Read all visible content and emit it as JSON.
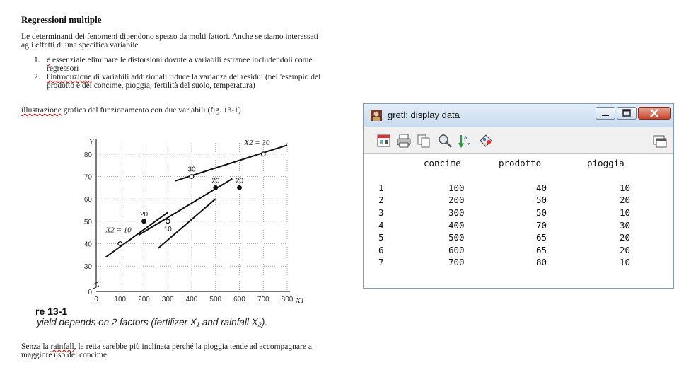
{
  "document": {
    "title": "Regressioni multiple",
    "intro": "Le determinanti dei fenomeni dipendono spesso da molti fattori. Anche se siamo interessati agli effetti di una specifica variabile",
    "list": [
      {
        "num": "1.",
        "word": "è",
        "rest": " essenziale eliminare le distorsioni dovute a variabili estranee includendoli come regressori"
      },
      {
        "num": "2.",
        "word": "l'introduzione",
        "rest": " di variabili addizionali riduce la varianza dei residui (nell'esempio del prodotto e del concime, pioggia, fertilità del suolo, temperatura)"
      }
    ],
    "illustration_word": "illustrazione",
    "illustration_rest": " grafica del funzionamento con due variabili (fig. 13-1)",
    "figure_number": "re 13-1",
    "figure_caption": "yield depends on 2 factors (fertilizer X₁ and rainfall X₂).",
    "footer_pre": "Senza la ",
    "footer_word": "rainfall",
    "footer_post": ", la retta sarebbe più inclinata perché la pioggia tende ad accompagnare a maggiore uso del concime"
  },
  "chart_data": {
    "type": "scatter",
    "title": "",
    "xlabel": "X1",
    "ylabel": "Y",
    "xlim": [
      0,
      800
    ],
    "ylim": [
      0,
      85
    ],
    "xticks": [
      "0",
      "100",
      "200",
      "300",
      "400",
      "500",
      "600",
      "700",
      "800"
    ],
    "yticks": [
      "0",
      "30",
      "40",
      "50",
      "60",
      "70",
      "80"
    ],
    "points": [
      {
        "x": 100,
        "y": 40,
        "label": "",
        "filled": false
      },
      {
        "x": 200,
        "y": 50,
        "label": "20",
        "filled": true
      },
      {
        "x": 300,
        "y": 50,
        "label": "10",
        "filled": false
      },
      {
        "x": 400,
        "y": 70,
        "label": "30",
        "filled": false
      },
      {
        "x": 500,
        "y": 65,
        "label": "20",
        "filled": true
      },
      {
        "x": 600,
        "y": 65,
        "label": "20",
        "filled": true
      },
      {
        "x": 700,
        "y": 80,
        "label": "",
        "filled": false
      }
    ],
    "lines": [
      {
        "name": "X2 = 10",
        "from": [
          40,
          34
        ],
        "to": [
          300,
          54
        ]
      },
      {
        "name": "",
        "from": [
          180,
          44
        ],
        "to": [
          570,
          69
        ]
      },
      {
        "name": "",
        "from": [
          260,
          38
        ],
        "to": [
          500,
          60
        ]
      },
      {
        "name": "X2 = 30",
        "from": [
          330,
          68
        ],
        "to": [
          800,
          84
        ]
      }
    ],
    "annotations": [
      {
        "text": "X2 = 10",
        "x": 40,
        "y": 45
      },
      {
        "text": "X2 = 30",
        "x": 620,
        "y": 84
      }
    ]
  },
  "gretl": {
    "window_title": "gretl: display data",
    "icons": [
      "app-icon",
      "edit-icon",
      "print-icon",
      "copy-icon",
      "search-icon",
      "sort-icon",
      "plot-icon",
      "expand-icon"
    ],
    "columns": [
      "concime",
      "prodotto",
      "pioggia"
    ],
    "rows": [
      {
        "id": "1",
        "values": [
          "100",
          "40",
          "10"
        ]
      },
      {
        "id": "2",
        "values": [
          "200",
          "50",
          "20"
        ]
      },
      {
        "id": "3",
        "values": [
          "300",
          "50",
          "10"
        ]
      },
      {
        "id": "4",
        "values": [
          "400",
          "70",
          "30"
        ]
      },
      {
        "id": "5",
        "values": [
          "500",
          "65",
          "20"
        ]
      },
      {
        "id": "6",
        "values": [
          "600",
          "65",
          "20"
        ]
      },
      {
        "id": "7",
        "values": [
          "700",
          "80",
          "10"
        ]
      }
    ],
    "close_color": "#c7442a"
  }
}
